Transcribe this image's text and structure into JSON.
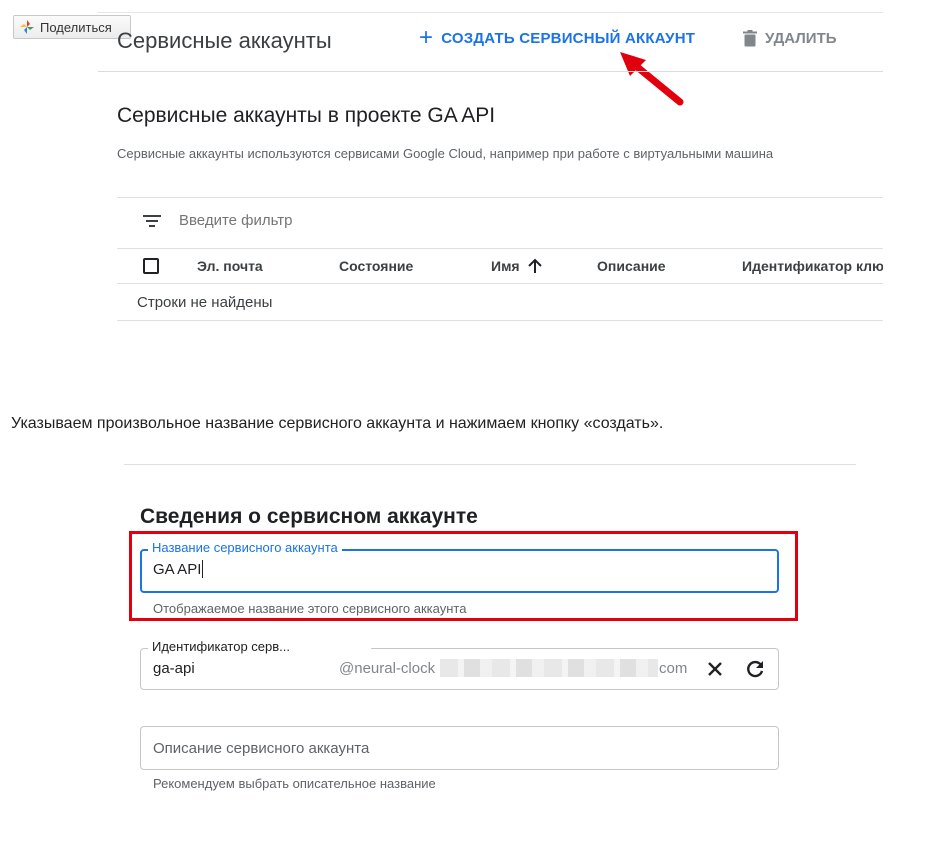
{
  "share": {
    "label": "Поделиться"
  },
  "console": {
    "page_title": "Сервисные аккаунты",
    "create_label": "СОЗДАТЬ СЕРВИСНЫЙ АККАУНТ",
    "delete_label": "УДАЛИТЬ",
    "section_title": "Сервисные аккаунты в проекте GA API",
    "section_subtitle": "Сервисные аккаунты используются сервисами Google Cloud, например при работе с виртуальными машина",
    "filter_placeholder": "Введите фильтр",
    "columns": [
      "Эл. почта",
      "Состояние",
      "Имя",
      "Описание",
      "Идентификатор клю"
    ],
    "empty_text": "Строки не найдены"
  },
  "paragraph": "Указываем произвольное название сервисного аккаунта и нажимаем кнопку «создать».",
  "form": {
    "title": "Сведения о сервисном аккаунте",
    "name_label": "Название сервисного аккаунта",
    "name_value": "GA API",
    "name_helper": "Отображаемое название этого сервисного аккаунта",
    "id_label": "Идентификатор серв...",
    "id_value": "ga-api",
    "id_domain_prefix": "@neural-clock",
    "id_domain_suffix": "com",
    "description_placeholder": "Описание сервисного аккаунта",
    "description_helper": "Рекомендуем выбрать описательное название"
  },
  "colors": {
    "accent": "#1a73e8",
    "highlight": "#e2000f"
  }
}
